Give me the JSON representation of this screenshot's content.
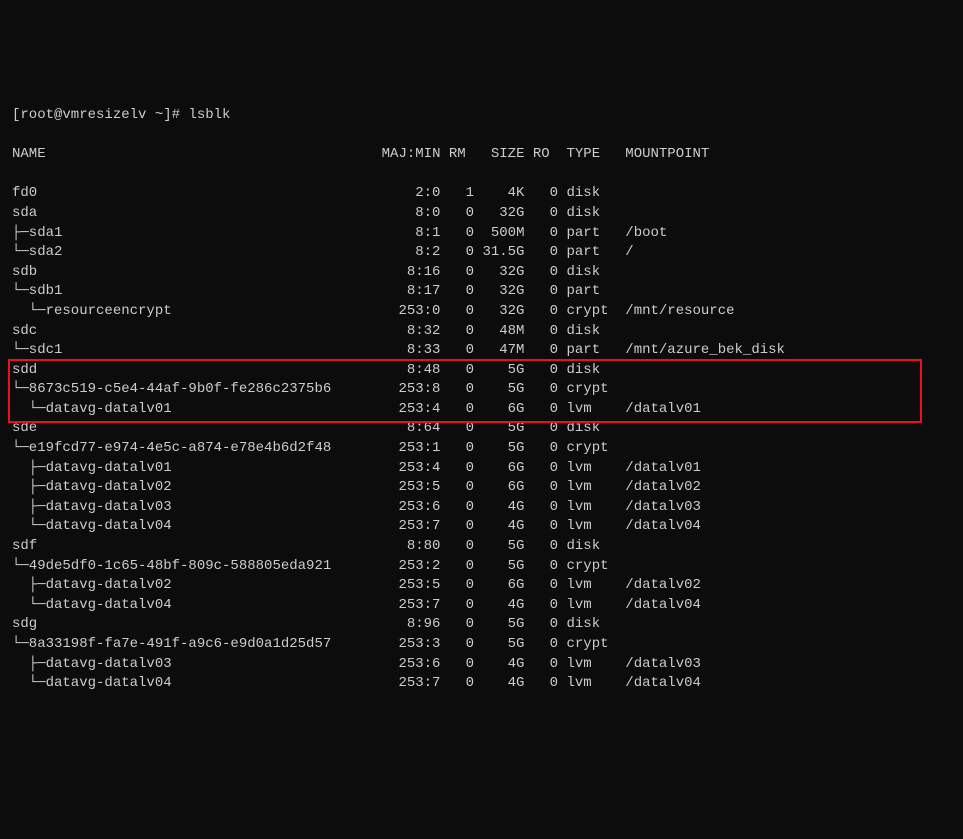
{
  "prompt": "[root@vmresizelv ~]# ",
  "command": "lsblk",
  "header": {
    "name": "NAME",
    "majmin": "MAJ:MIN",
    "rm": "RM",
    "size": "SIZE",
    "ro": "RO",
    "type": "TYPE",
    "mount": "MOUNTPOINT"
  },
  "rows": [
    {
      "name": "fd0",
      "majmin": "2:0",
      "rm": "1",
      "size": "4K",
      "ro": "0",
      "type": "disk",
      "mount": ""
    },
    {
      "name": "sda",
      "majmin": "8:0",
      "rm": "0",
      "size": "32G",
      "ro": "0",
      "type": "disk",
      "mount": ""
    },
    {
      "name": "├─sda1",
      "majmin": "8:1",
      "rm": "0",
      "size": "500M",
      "ro": "0",
      "type": "part",
      "mount": "/boot"
    },
    {
      "name": "└─sda2",
      "majmin": "8:2",
      "rm": "0",
      "size": "31.5G",
      "ro": "0",
      "type": "part",
      "mount": "/"
    },
    {
      "name": "sdb",
      "majmin": "8:16",
      "rm": "0",
      "size": "32G",
      "ro": "0",
      "type": "disk",
      "mount": ""
    },
    {
      "name": "└─sdb1",
      "majmin": "8:17",
      "rm": "0",
      "size": "32G",
      "ro": "0",
      "type": "part",
      "mount": ""
    },
    {
      "name": "  └─resourceencrypt",
      "majmin": "253:0",
      "rm": "0",
      "size": "32G",
      "ro": "0",
      "type": "crypt",
      "mount": "/mnt/resource"
    },
    {
      "name": "sdc",
      "majmin": "8:32",
      "rm": "0",
      "size": "48M",
      "ro": "0",
      "type": "disk",
      "mount": ""
    },
    {
      "name": "└─sdc1",
      "majmin": "8:33",
      "rm": "0",
      "size": "47M",
      "ro": "0",
      "type": "part",
      "mount": "/mnt/azure_bek_disk"
    },
    {
      "name": "sdd",
      "majmin": "8:48",
      "rm": "0",
      "size": "5G",
      "ro": "0",
      "type": "disk",
      "mount": ""
    },
    {
      "name": "└─8673c519-c5e4-44af-9b0f-fe286c2375b6",
      "majmin": "253:8",
      "rm": "0",
      "size": "5G",
      "ro": "0",
      "type": "crypt",
      "mount": ""
    },
    {
      "name": "  └─datavg-datalv01",
      "majmin": "253:4",
      "rm": "0",
      "size": "6G",
      "ro": "0",
      "type": "lvm",
      "mount": "/datalv01"
    },
    {
      "name": "sde",
      "majmin": "8:64",
      "rm": "0",
      "size": "5G",
      "ro": "0",
      "type": "disk",
      "mount": ""
    },
    {
      "name": "└─e19fcd77-e974-4e5c-a874-e78e4b6d2f48",
      "majmin": "253:1",
      "rm": "0",
      "size": "5G",
      "ro": "0",
      "type": "crypt",
      "mount": ""
    },
    {
      "name": "  ├─datavg-datalv01",
      "majmin": "253:4",
      "rm": "0",
      "size": "6G",
      "ro": "0",
      "type": "lvm",
      "mount": "/datalv01"
    },
    {
      "name": "  ├─datavg-datalv02",
      "majmin": "253:5",
      "rm": "0",
      "size": "6G",
      "ro": "0",
      "type": "lvm",
      "mount": "/datalv02"
    },
    {
      "name": "  ├─datavg-datalv03",
      "majmin": "253:6",
      "rm": "0",
      "size": "4G",
      "ro": "0",
      "type": "lvm",
      "mount": "/datalv03"
    },
    {
      "name": "  └─datavg-datalv04",
      "majmin": "253:7",
      "rm": "0",
      "size": "4G",
      "ro": "0",
      "type": "lvm",
      "mount": "/datalv04"
    },
    {
      "name": "sdf",
      "majmin": "8:80",
      "rm": "0",
      "size": "5G",
      "ro": "0",
      "type": "disk",
      "mount": ""
    },
    {
      "name": "└─49de5df0-1c65-48bf-809c-588805eda921",
      "majmin": "253:2",
      "rm": "0",
      "size": "5G",
      "ro": "0",
      "type": "crypt",
      "mount": ""
    },
    {
      "name": "  ├─datavg-datalv02",
      "majmin": "253:5",
      "rm": "0",
      "size": "6G",
      "ro": "0",
      "type": "lvm",
      "mount": "/datalv02"
    },
    {
      "name": "  └─datavg-datalv04",
      "majmin": "253:7",
      "rm": "0",
      "size": "4G",
      "ro": "0",
      "type": "lvm",
      "mount": "/datalv04"
    },
    {
      "name": "sdg",
      "majmin": "8:96",
      "rm": "0",
      "size": "5G",
      "ro": "0",
      "type": "disk",
      "mount": ""
    },
    {
      "name": "└─8a33198f-fa7e-491f-a9c6-e9d0a1d25d57",
      "majmin": "253:3",
      "rm": "0",
      "size": "5G",
      "ro": "0",
      "type": "crypt",
      "mount": ""
    },
    {
      "name": "  ├─datavg-datalv03",
      "majmin": "253:6",
      "rm": "0",
      "size": "4G",
      "ro": "0",
      "type": "lvm",
      "mount": "/datalv03"
    },
    {
      "name": "  └─datavg-datalv04",
      "majmin": "253:7",
      "rm": "0",
      "size": "4G",
      "ro": "0",
      "type": "lvm",
      "mount": "/datalv04"
    }
  ],
  "highlight": {
    "startRow": 9,
    "endRow": 11
  }
}
